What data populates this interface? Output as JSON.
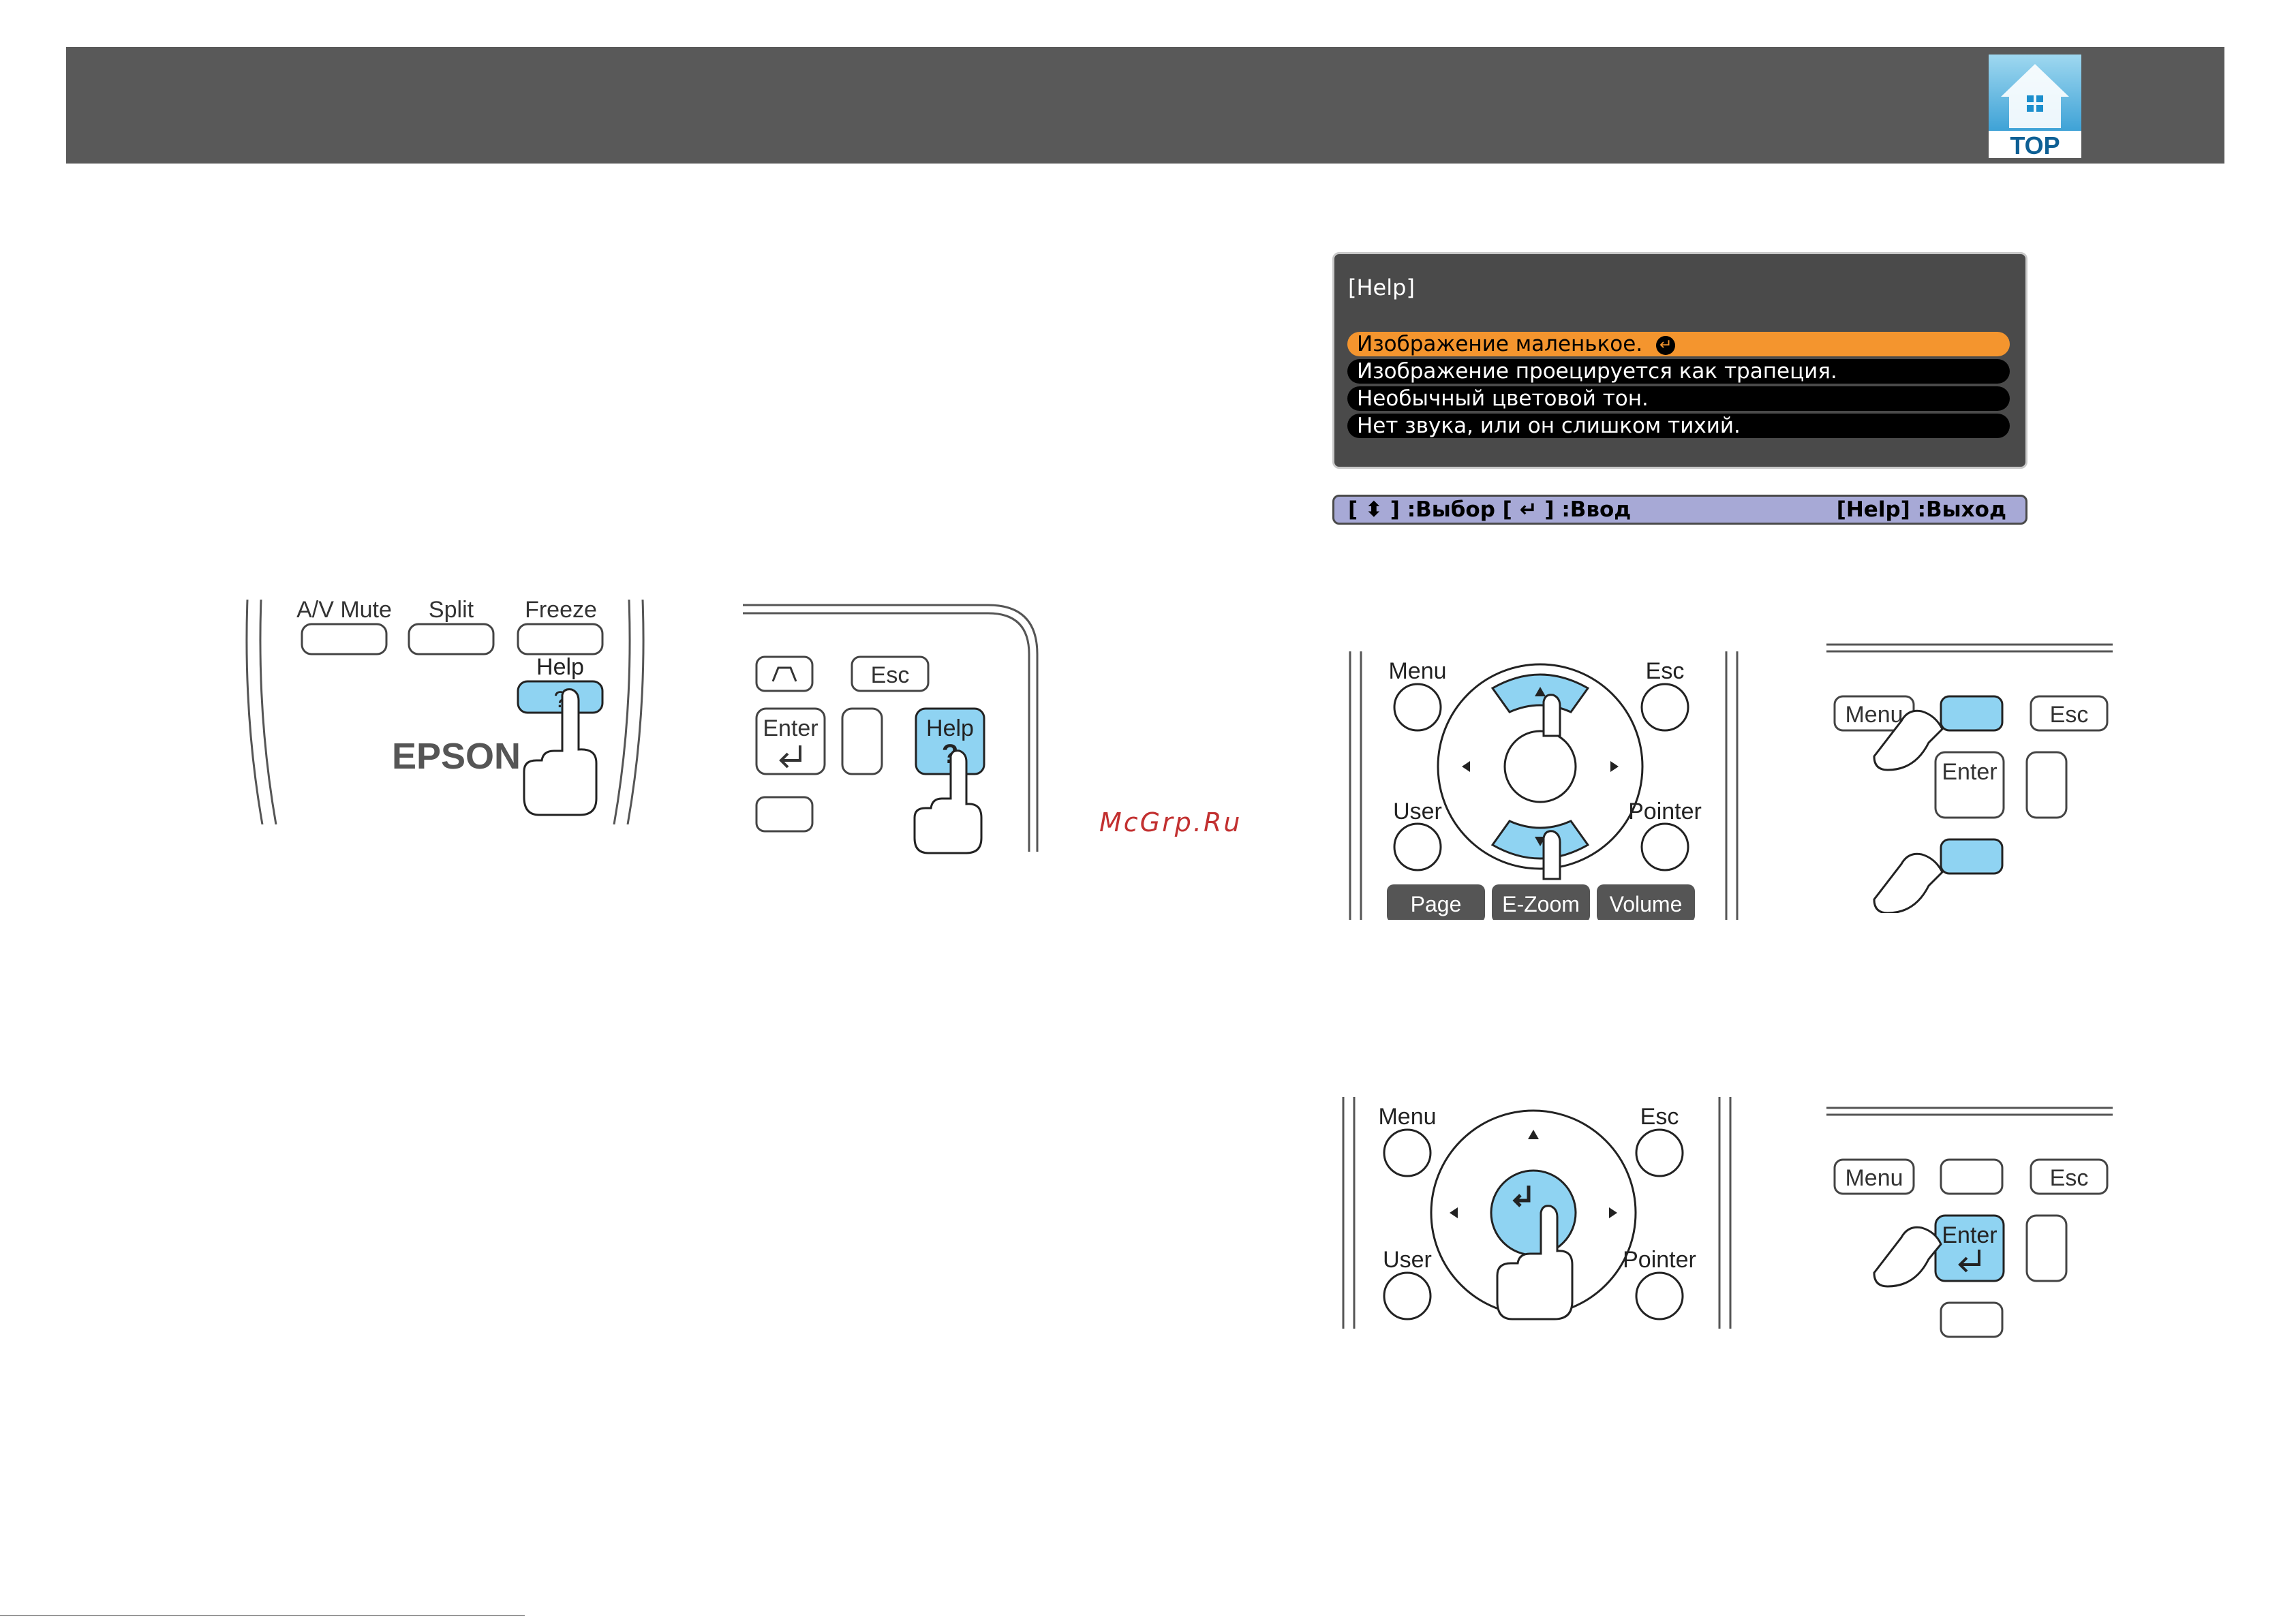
{
  "header": {
    "top_label": "TOP"
  },
  "help_menu": {
    "title": "[Help]",
    "items": [
      "Изображение маленькое.",
      "Изображение проецируется как трапеция.",
      "Необычный цветовой тон.",
      "Нет звука, или он слишком тихий."
    ],
    "selected_index": 0,
    "status_left": "[ ⬍ ] :Выбор  [ ↵ ] :Ввод",
    "status_right": "[Help] :Выход",
    "colors": {
      "selected": "#f4952e",
      "panel": "#4a4a4a",
      "status": "#a7a9d6"
    }
  },
  "remote_1": {
    "buttons": [
      "A/V Mute",
      "Split",
      "Freeze",
      "Help"
    ],
    "help_glyph": "?",
    "brand": "EPSON"
  },
  "panel_1": {
    "buttons": [
      "Esc",
      "Enter",
      "Help"
    ],
    "help_glyph": "?"
  },
  "watermark": "McGrp.Ru",
  "remote_2": {
    "labels": [
      "Menu",
      "Esc",
      "User",
      "Pointer",
      "Page",
      "E-Zoom",
      "Volume"
    ]
  },
  "panel_2": {
    "labels": [
      "Menu",
      "Esc",
      "Enter"
    ]
  },
  "remote_3": {
    "labels": [
      "Menu",
      "Esc",
      "User",
      "Pointer"
    ]
  },
  "panel_3": {
    "labels": [
      "Menu",
      "Esc",
      "Enter"
    ]
  }
}
